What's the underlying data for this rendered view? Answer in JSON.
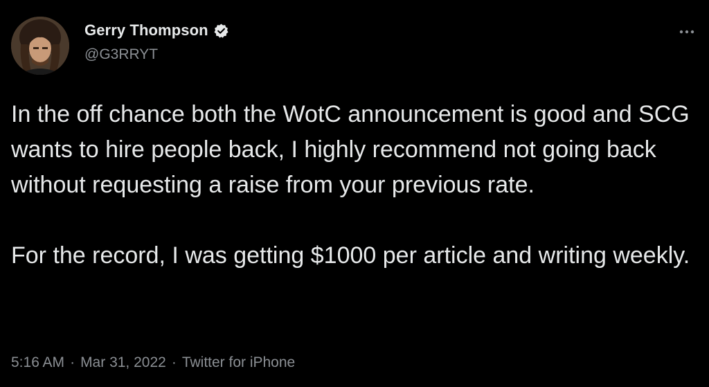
{
  "author": {
    "display_name": "Gerry Thompson",
    "handle": "@G3RRYT",
    "verified": true,
    "avatar_icon": "user-avatar"
  },
  "tweet": {
    "paragraphs": [
      "In the off chance both the WotC announcement is good and SCG wants to hire people back, I highly recommend not going back without requesting a raise from your previous rate.",
      "For the record, I was getting $1000 per article and writing weekly."
    ]
  },
  "meta": {
    "time": "5:16 AM",
    "separator": "·",
    "date": "Mar 31, 2022",
    "source": "Twitter for iPhone"
  },
  "icons": {
    "verified": "verified-badge-icon",
    "more": "more-options-icon"
  },
  "colors": {
    "background": "#000000",
    "primary_text": "#e7e9ea",
    "secondary_text": "#8b8f94"
  }
}
